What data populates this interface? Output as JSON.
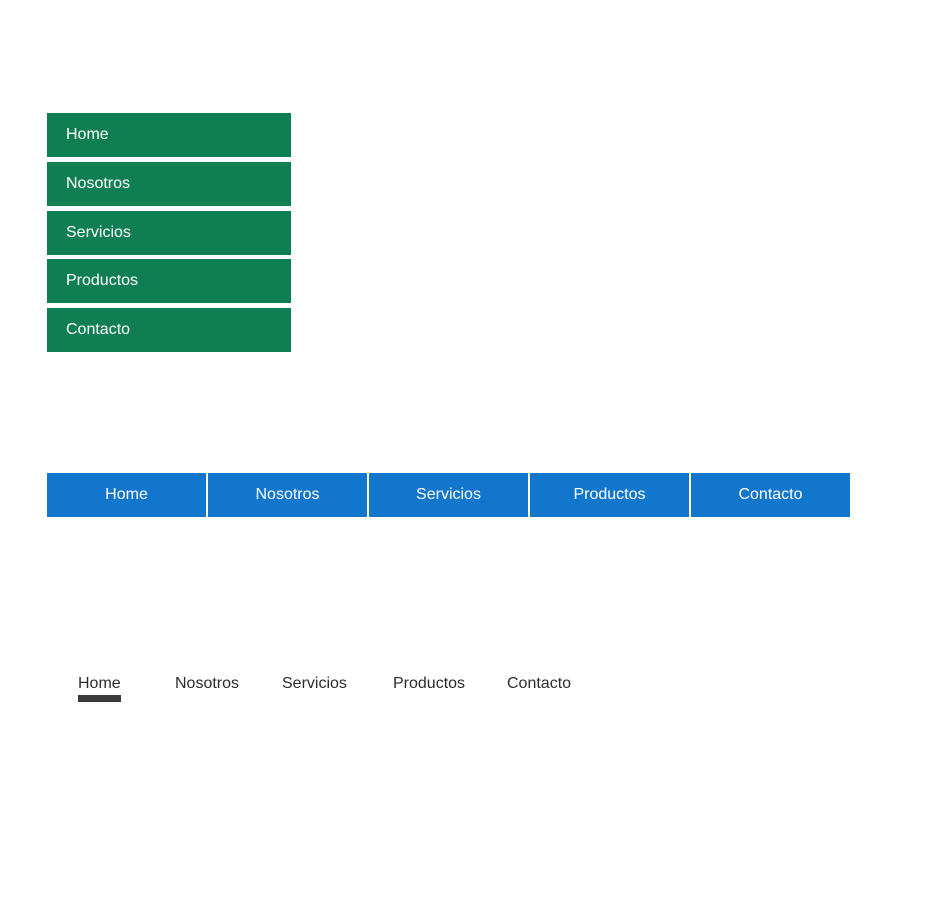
{
  "vertical_menu": {
    "items": [
      "Home",
      "Nosotros",
      "Servicios",
      "Productos",
      "Contacto"
    ]
  },
  "horizontal_menu": {
    "items": [
      "Home",
      "Nosotros",
      "Servicios",
      "Productos",
      "Contacto"
    ]
  },
  "text_nav": {
    "items": [
      "Home",
      "Nosotros",
      "Servicios",
      "Productos",
      "Contacto"
    ],
    "active": "Home"
  },
  "colors": {
    "green_menu": "#0f7f53",
    "blue_menu": "#1276cd",
    "text_nav": "#2c2c2c",
    "active_underline": "#3b3b3b"
  }
}
